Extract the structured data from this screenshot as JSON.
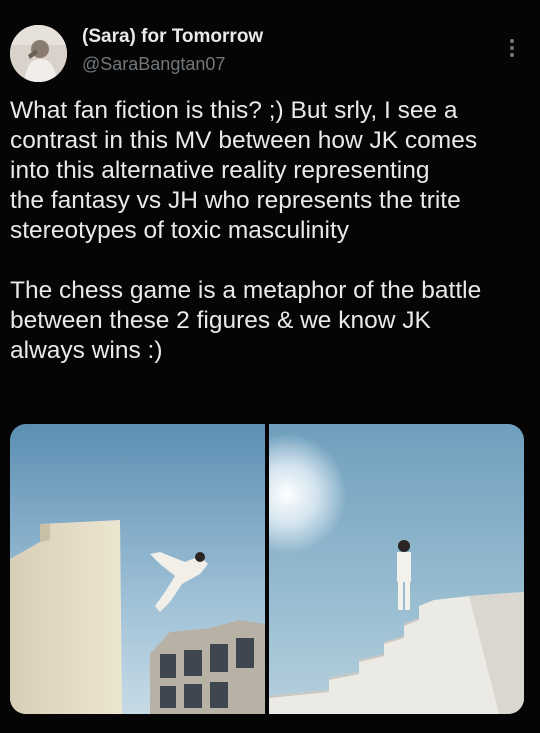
{
  "tweet": {
    "author": {
      "display_name": "(Sara) for Tomorrow",
      "handle": "@SaraBangtan07"
    },
    "text_paragraphs": [
      "What fan fiction is this? ;) But srly, I see a\ncontrast in this MV between how JK comes\ninto this alternative reality representing\nthe fantasy vs JH who represents the trite\nstereotypes of toxic masculinity",
      "The chess game is a metaphor of the battle\nbetween these 2 figures & we know JK\nalways wins :)"
    ],
    "media": [
      {
        "icon": "photo-leaping-figure"
      },
      {
        "icon": "photo-figure-on-stairs"
      }
    ]
  },
  "colors": {
    "background": "#050505",
    "primary_text": "#e7e9ea",
    "secondary_text": "#71767b"
  }
}
